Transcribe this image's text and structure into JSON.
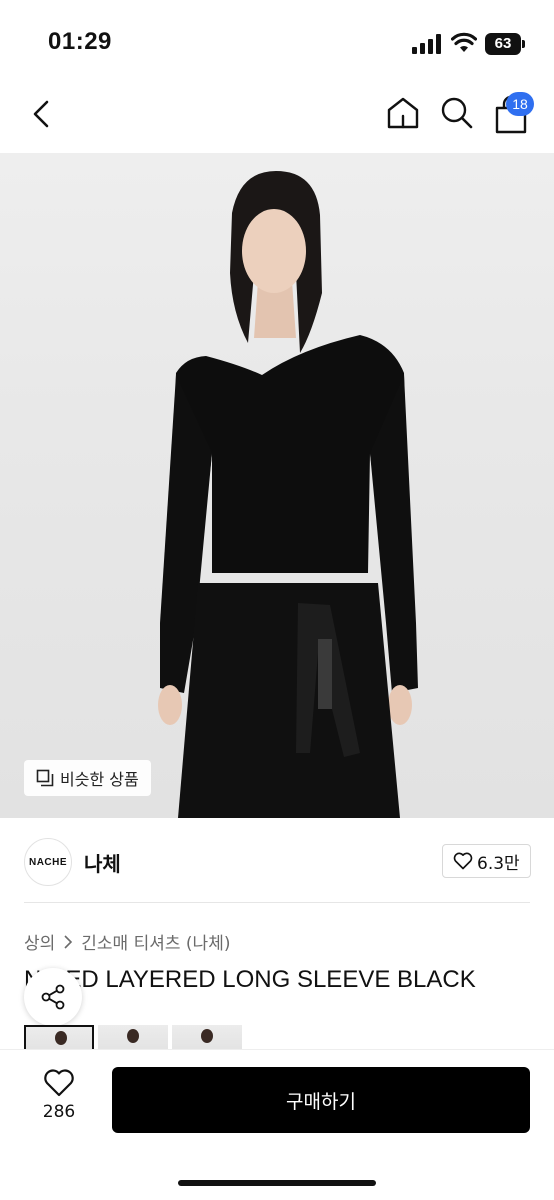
{
  "status_bar": {
    "time": "01:29",
    "battery": "63"
  },
  "nav": {
    "cart_badge": "18"
  },
  "product_image": {
    "similar_label": "비슷한 상품"
  },
  "brand": {
    "logo_text": "NACHE",
    "name": "나체",
    "like_count": "6.3만"
  },
  "breadcrumb": {
    "category": "상의",
    "subcategory": "긴소매 티셔츠 (나체)"
  },
  "product": {
    "title": "N…ED LAYERED LONG SLEEVE BLACK"
  },
  "bottom_bar": {
    "wish_count": "286",
    "buy_label": "구매하기"
  },
  "colors": {
    "accent_badge": "#2f6ff0",
    "buy_button": "#000000"
  },
  "icons": [
    "chevron-left-icon",
    "home-icon",
    "search-icon",
    "shopping-bag-icon",
    "copy-icon",
    "heart-icon",
    "share-icon"
  ]
}
